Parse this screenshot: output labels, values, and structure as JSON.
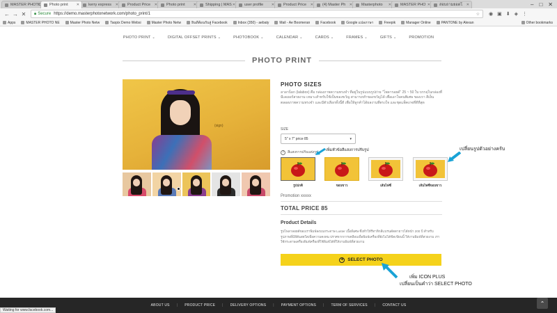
{
  "browser": {
    "tabs": [
      {
        "label": "MASTER PHOTO"
      },
      {
        "label": "Photo print",
        "active": true
      },
      {
        "label": "kerry express"
      },
      {
        "label": "Product Price"
      },
      {
        "label": "Photo print"
      },
      {
        "label": "Shipping | MAS"
      },
      {
        "label": "user profile"
      },
      {
        "label": "Product Price"
      },
      {
        "label": "(4) Master Ph"
      },
      {
        "label": "Masterphoto"
      },
      {
        "label": "MASTER PHO"
      },
      {
        "label": "สอบถามยอดโ"
      }
    ],
    "secure_label": "Secure",
    "url": "https://demo.masterphotonetwork.com/photo_print/1",
    "bookmarks": [
      {
        "label": "Apps"
      },
      {
        "label": "MASTER PHOTO NE"
      },
      {
        "label": "Master Photo Netw"
      },
      {
        "label": "Taopix Demo Websi"
      },
      {
        "label": "Master Photo Netw"
      },
      {
        "label": "ยินดีต้อนรับสู่ Facebook"
      },
      {
        "label": "Inbox (350) - aebaty"
      },
      {
        "label": "Mail - Ae Boomeran"
      },
      {
        "label": "Facebook"
      },
      {
        "label": "Google แปลภาษา"
      },
      {
        "label": "Freepik"
      },
      {
        "label": "Manager Online"
      },
      {
        "label": "PANTONE by Alexan"
      }
    ],
    "other_bookmarks": "Other bookmarks",
    "status_text": "Waiting for www.facebook.com..."
  },
  "site_nav": [
    {
      "label": "PHOTO PRINT",
      "has_caret": true
    },
    {
      "label": "DIGITAL OFFSET PRINTS",
      "has_caret": true
    },
    {
      "label": "PHOTOBOOK",
      "has_caret": true
    },
    {
      "label": "CALENDAR",
      "has_caret": true
    },
    {
      "label": "CARDS",
      "has_caret": true
    },
    {
      "label": "FRAMES",
      "has_caret": true
    },
    {
      "label": "GIFTS",
      "has_caret": true
    },
    {
      "label": "PROMOTION",
      "has_caret": false
    }
  ],
  "page": {
    "title": "PHOTO PRINT",
    "photo_caption": "(sign)",
    "sizes_title": "PHOTO SIZES",
    "sizes_desc": "ลาลาบ็อก (lalabox) คือ กล่องภาพความทรงจำ ที่อยู่ในรูปแบบรูปถ่าย \"โพลารอยด์\" 25 ~ 50 ใบ บรรจุในกล่องที่มีเลเยอร์สวยงาม เหมาะสำหรับใช้เป็นของขวัญ สามารถทำของขวัญได้ เพื่อเอาใจคนพิเศษ ของเรา สีเย็นตลอดภาพความทรงจำ และมีตัวเลือกทั้งนี้ดี เพื่อให้ลูกค้าได้ผลงานที่ตรงใจ และชุดแพ็คเกจที่ดีที่สุด",
    "size_label": "SIZE",
    "size_value": "5\" x 7\" price 85",
    "color_hint": "สีแสงการปรับแต่งรูป",
    "options": [
      {
        "label": "รูปปกติ",
        "selected": true
      },
      {
        "label": "ขอบขาว",
        "selected": false
      },
      {
        "label": "เส้นไฟซี่",
        "selected": false
      },
      {
        "label": "เส้นไฟซี่ขอบขาว",
        "selected": false
      }
    ],
    "promotion": "Promotion xxxxx",
    "total_price": "TOTAL PRICE 85",
    "details_title": "Product Details",
    "details_text": "รูปโพลาลอยด์ของเราพิมพ์ลงบนกระดาษ Luster เนื้อพิเศษ ซึ่งทำให้รีทาทิกสีเเบรนด์ดดายาวได้หน้า 200 ปี สำหรับรูปภาพที่มีสีสันสดใสเพื่อความคงทน ปราศจากการเคลือบเพื่อพิมพ์เครื่องที่ยังไม่ได้ขีดเขียนนี้ ให้งานพิมพ์ที่สวยงาม เราใช้กระดาษเครื่องพิมพ์ครื่องที่ใช้พิมพ์ได้ที่ให้งานพิมพ์ที่สวยงาม",
    "select_button": "SELECT PHOTO"
  },
  "annotations": {
    "note_color": "เพิ่มหัวข้อสีแสงการปรับรูป",
    "note_example": "เปลี่ยนรูปตัวอย่างครับ",
    "note_icon": "เพิ่ม ICON PLUS",
    "note_select": "เปลี่ยนเป็นคำว่า SELECT PHOTO",
    "arrow_color": "#1aa3d6"
  },
  "footer": {
    "links": [
      "ABOUT US",
      "PRODUCT PRICE",
      "DELIVERY OPTIONS",
      "PAYMENT OPTIONS",
      "TERM OF SERVICES",
      "CONTACT US"
    ]
  },
  "colors": {
    "accent_yellow": "#f5d21b",
    "footer_bg": "#262626"
  }
}
